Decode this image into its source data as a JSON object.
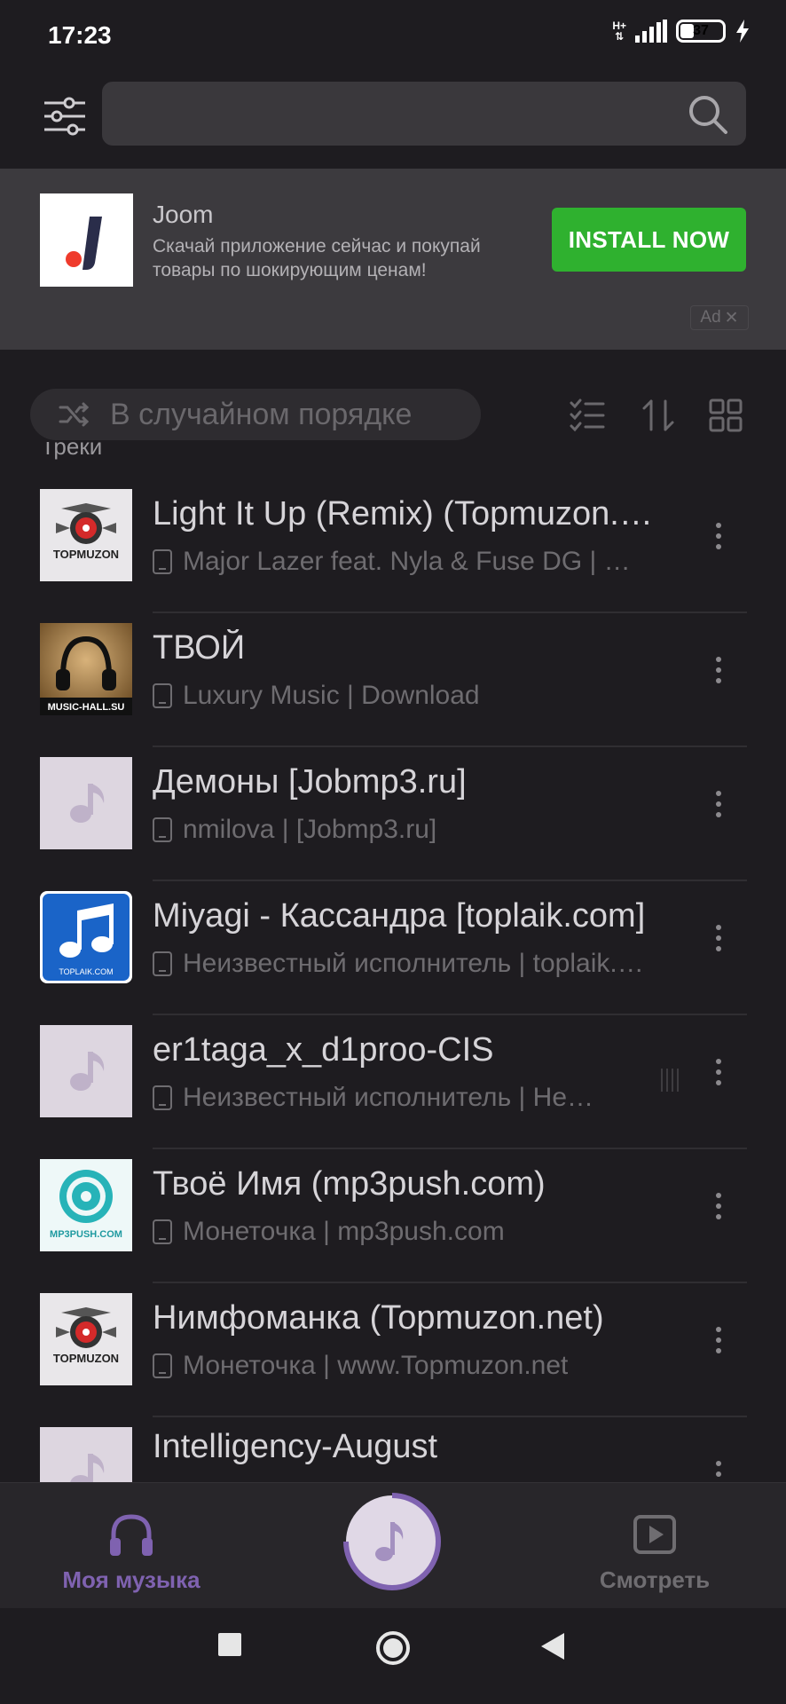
{
  "status_bar": {
    "time": "17:23",
    "network": "H+",
    "battery": "37",
    "battery_level": 0.37
  },
  "search": {
    "placeholder": "",
    "value": ""
  },
  "ad": {
    "title": "Joom",
    "description": "Скачай приложение сейчас и покупай товары по шокирующим ценам!",
    "install_label": "INSTALL NOW",
    "ad_label": "Ad",
    "close_glyph": "✕",
    "install_color": "#2fb12f"
  },
  "controls": {
    "shuffle_label": "В случайном порядке"
  },
  "section": {
    "title": "Треки"
  },
  "tracks": [
    {
      "title": "Light It Up (Remix) (Topmuzon.net)",
      "subtitle": "Major Lazer feat. Nyla & Fuse DG | www.Topmuzon.net",
      "cover": "topmuzon"
    },
    {
      "title": "ТВОЙ",
      "subtitle": "Luxury Music | Download",
      "cover": "music-hall"
    },
    {
      "title": "Демоны [Jobmp3.ru]",
      "subtitle": "nmilova | [Jobmp3.ru]",
      "cover": "placeholder"
    },
    {
      "title": "Miyagi - Кассандра [toplaik.com]",
      "subtitle": "Неизвестный исполнитель | toplaik.com",
      "cover": "toplaik"
    },
    {
      "title": "er1taga_x_d1proo-CIS",
      "subtitle": "Неизвестный исполнитель | Неизвестный альбом",
      "cover": "placeholder"
    },
    {
      "title": "Твоё Имя (mp3push.com)",
      "subtitle": "Монеточка | mp3push.com",
      "cover": "mp3push"
    },
    {
      "title": "Нимфоманка (Topmuzon.net)",
      "subtitle": "Монеточка | www.Topmuzon.net",
      "cover": "topmuzon"
    },
    {
      "title": "Intelligency-August",
      "subtitle": "",
      "cover": "placeholder"
    }
  ],
  "cover_text": {
    "topmuzon": "TOPMUZON",
    "music_hall": "MUSIC-HALL.SU",
    "toplaik": "TOPLAIK.COM",
    "mp3push": "MP3PUSH.COM"
  },
  "bottom_nav": {
    "my_music": "Моя музыка",
    "watch": "Смотреть",
    "accent": "#7f62b0"
  }
}
